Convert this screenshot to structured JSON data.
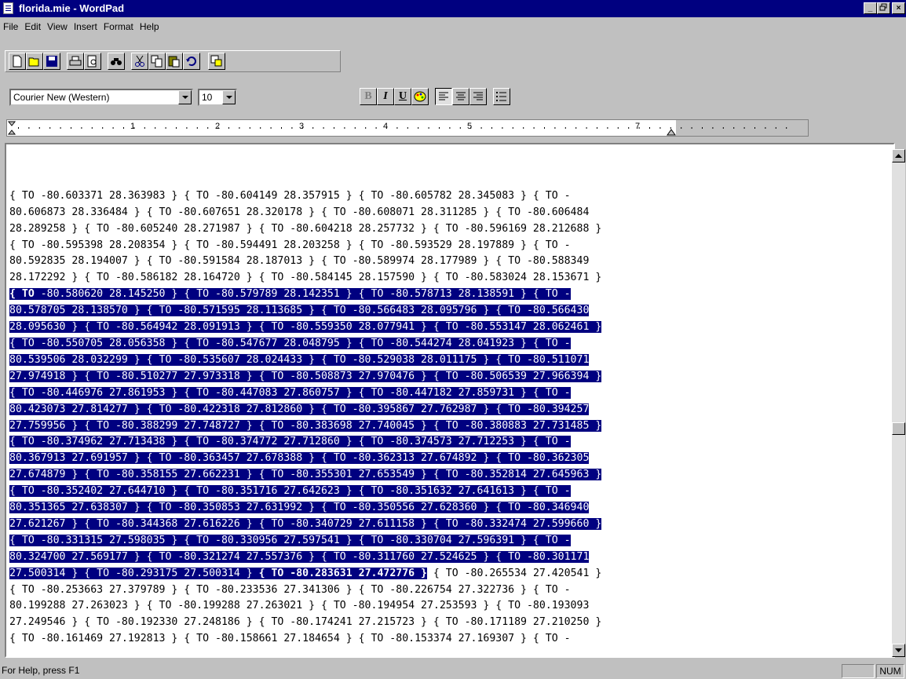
{
  "window": {
    "title": "florida.mie - WordPad",
    "minimize": "_",
    "maximize": "▫",
    "close": "×"
  },
  "menu": {
    "file": "File",
    "edit": "Edit",
    "view": "View",
    "insert": "Insert",
    "format": "Format",
    "help": "Help"
  },
  "toolbar": {
    "buttons": [
      "new-icon",
      "open-icon",
      "save-icon",
      "print-icon",
      "print-preview-icon",
      "find-icon",
      "cut-icon",
      "copy-icon",
      "paste-icon",
      "undo-icon",
      "insert-object-icon"
    ]
  },
  "format_bar": {
    "font": "Courier New (Western)",
    "size": "10",
    "bold": "B",
    "italic": "I",
    "underline": "U"
  },
  "ruler": {
    "numbers": [
      "1",
      "2",
      "3",
      "4",
      "5",
      "7"
    ]
  },
  "document": {
    "lines_before": [
      "{ TO -80.603371 28.363983 } { TO -80.604149 28.357915 } { TO -80.605782 28.345083 } { TO -",
      "80.606873 28.336484 } { TO -80.607651 28.320178 } { TO -80.608071 28.311285 } { TO -80.606484",
      "28.289258 } { TO -80.605240 28.271987 } { TO -80.604218 28.257732 } { TO -80.596169 28.212688 }",
      "{ TO -80.595398 28.208354 } { TO -80.594491 28.203258 } { TO -80.593529 28.197889 } { TO -",
      "80.592835 28.194007 } { TO -80.591584 28.187013 } { TO -80.589974 28.177989 } { TO -80.588349",
      "28.172292 } { TO -80.586182 28.164720 } { TO -80.584145 28.157590 } { TO -80.583024 28.153671 }"
    ],
    "sel_start_bold": "{ TO ",
    "sel_first": "-80.580620 28.145250 }",
    "sel_first_rest": " { TO -80.579789 28.142351 } { TO -80.578713 28.138591 } { TO -",
    "selected_lines": [
      "80.578705 28.138570 } { TO -80.571595 28.113685 } { TO -80.566483 28.095796 } { TO -80.566430",
      "28.095630 } { TO -80.564942 28.091913 } { TO -80.559350 28.077941 } { TO -80.553147 28.062461 }",
      "{ TO -80.550705 28.056358 } { TO -80.547677 28.048795 } { TO -80.544274 28.041923 } { TO -",
      "80.539506 28.032299 } { TO -80.535607 28.024433 } { TO -80.529038 28.011175 } { TO -80.511071",
      "27.974918 } { TO -80.510277 27.973318 } { TO -80.508873 27.970476 } { TO -80.506539 27.966394 }",
      "{ TO -80.446976 27.861953 } { TO -80.447083 27.860757 } { TO -80.447182 27.859731 } { TO -",
      "80.423073 27.814277 } { TO -80.422318 27.812860 } { TO -80.395867 27.762987 } { TO -80.394257",
      "27.759956 } { TO -80.388299 27.748727 } { TO -80.383698 27.740045 } { TO -80.380883 27.731485 }",
      "{ TO -80.374962 27.713438 } { TO -80.374772 27.712860 } { TO -80.374573 27.712253 } { TO -",
      "80.367913 27.691957 } { TO -80.363457 27.678388 } { TO -80.362313 27.674892 } { TO -80.362305",
      "27.674879 } { TO -80.358155 27.662231 } { TO -80.355301 27.653549 } { TO -80.352814 27.645963 }",
      "{ TO -80.352402 27.644710 } { TO -80.351716 27.642623 } { TO -80.351632 27.641613 } { TO -",
      "80.351365 27.638307 } { TO -80.350853 27.631992 } { TO -80.350556 27.628360 } { TO -80.346940",
      "27.621267 } { TO -80.344368 27.616226 } { TO -80.340729 27.611158 } { TO -80.332474 27.599660 }",
      "{ TO -80.331315 27.598035 } { TO -80.330956 27.597541 } { TO -80.330704 27.596391 } { TO -",
      "80.324700 27.569177 } { TO -80.321274 27.557376 } { TO -80.311760 27.524625 } { TO -80.301171"
    ],
    "sel_last_plain": "27.500314 } { TO -80.293175 27.500314 } ",
    "sel_last_bold": "{ TO -80.283631 27.472776 }",
    "after_sel": " { TO -80.265534 27.420541 }",
    "lines_after": [
      "{ TO -80.253663 27.379789 } { TO -80.233536 27.341306 } { TO -80.226754 27.322736 } { TO -",
      "80.199288 27.263023 } { TO -80.199288 27.263021 } { TO -80.194954 27.253593 } { TO -80.193093",
      "27.249546 } { TO -80.192330 27.248186 } { TO -80.174241 27.215723 } { TO -80.171189 27.210250 }",
      "{ TO -80.161469 27.192813 } { TO -80.158661 27.184654 } { TO -80.153374 27.169307 } { TO -"
    ]
  },
  "status": {
    "help": "For Help, press F1",
    "num": "NUM"
  }
}
